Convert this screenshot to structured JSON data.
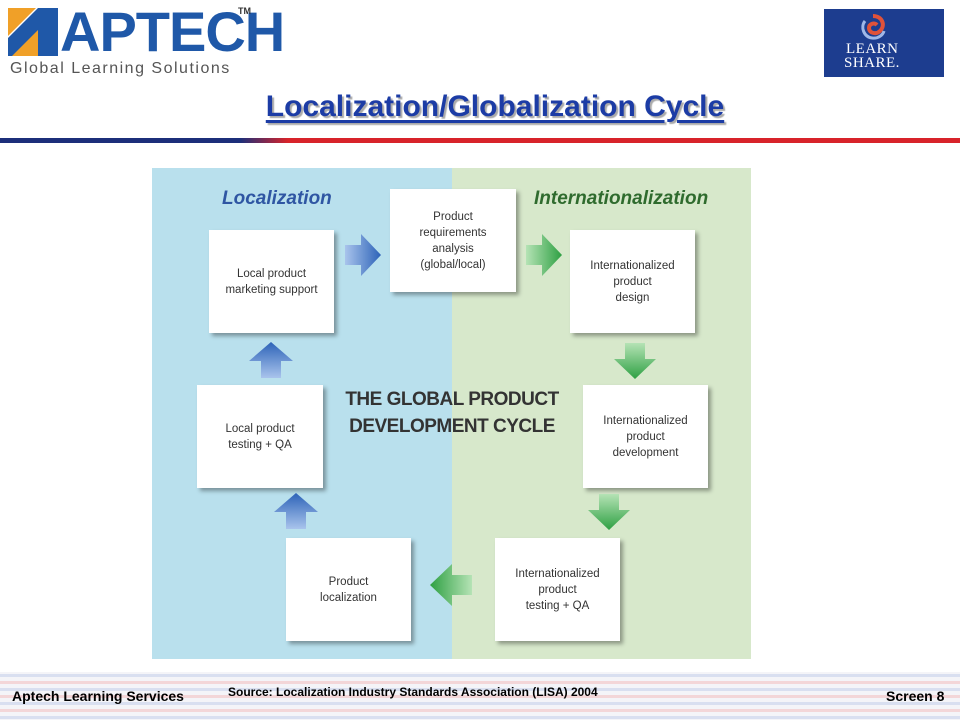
{
  "header": {
    "logo_text": "APTECH",
    "logo_tm": "TM",
    "logo_tagline": "Global Learning Solutions",
    "partner_logo_line1": "LEARN",
    "partner_logo_line2": "SHARE.",
    "title": "Localization/Globalization Cycle"
  },
  "diagram": {
    "left_label": "Localization",
    "right_label": "Internationalization",
    "center_title_line1": "THE GLOBAL PRODUCT",
    "center_title_line2": "DEVELOPMENT CYCLE",
    "steps": [
      {
        "line1": "Product",
        "line2": "requirements",
        "line3": "analysis",
        "line4": "(global/local)"
      },
      {
        "line1": "Internationalized",
        "line2": "product",
        "line3": "design"
      },
      {
        "line1": "Internationalized",
        "line2": "product",
        "line3": "development"
      },
      {
        "line1": "Internationalized",
        "line2": "product",
        "line3": "testing + QA"
      },
      {
        "line1": "Product",
        "line2": "localization"
      },
      {
        "line1": "Local product",
        "line2": "testing + QA"
      },
      {
        "line1": "Local product",
        "line2": "marketing support"
      }
    ],
    "colors": {
      "left_bg": "#b9e0ed",
      "right_bg": "#d7e8cb",
      "left_label": "#2f56a3",
      "right_label": "#2f6b2e",
      "blue_arrow": "#3a72c0",
      "green_arrow": "#3fae4a"
    }
  },
  "footer": {
    "left": "Aptech Learning Services",
    "source": "Source: Localization Industry Standards Association (LISA) 2004",
    "right": "Screen 8"
  },
  "colors": {
    "brand_blue": "#1f58a8",
    "title_blue": "#1c3ca5",
    "logo_orange": "#f0a028",
    "rule_red": "#d8232a"
  }
}
